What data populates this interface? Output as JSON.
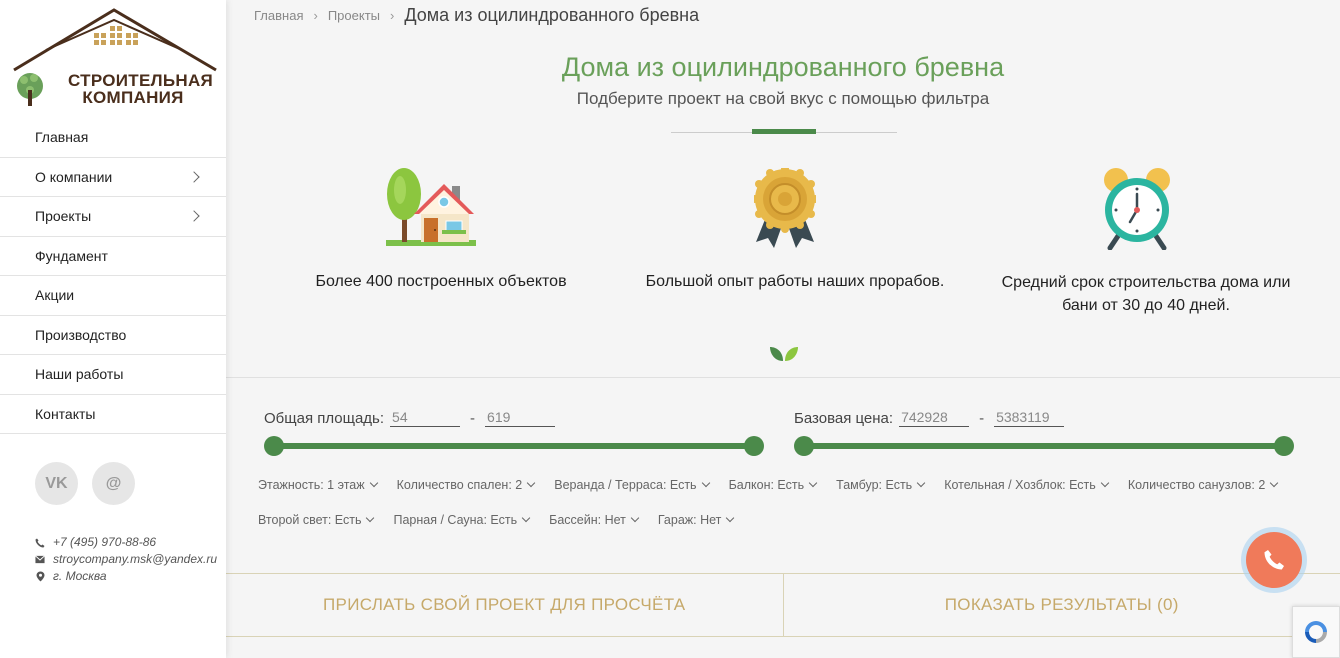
{
  "sidebar": {
    "logo": {
      "line1": "СТРОИТЕЛЬНАЯ",
      "line2": "КОМПАНИЯ"
    },
    "nav": [
      {
        "label": "Главная",
        "has_submenu": false
      },
      {
        "label": "О компании",
        "has_submenu": true
      },
      {
        "label": "Проекты",
        "has_submenu": true
      },
      {
        "label": "Фундамент",
        "has_submenu": false
      },
      {
        "label": "Акции",
        "has_submenu": false
      },
      {
        "label": "Производство",
        "has_submenu": false
      },
      {
        "label": "Наши работы",
        "has_submenu": false
      },
      {
        "label": "Контакты",
        "has_submenu": false
      }
    ],
    "socials": [
      {
        "icon": "vk-icon",
        "label": "VK"
      },
      {
        "icon": "email-at-icon",
        "label": "@"
      }
    ],
    "contacts": {
      "phone": "+7 (495) 970-88-86",
      "email": "stroycompany.msk@yandex.ru",
      "city": "г. Москва"
    }
  },
  "breadcrumb": {
    "home": "Главная",
    "projects": "Проекты",
    "current": "Дома из оцилиндрованного бревна"
  },
  "hero": {
    "title": "Дома из оцилиндрованного бревна",
    "subtitle": "Подберите проект на свой вкус с помощью фильтра"
  },
  "features": [
    {
      "icon": "house-tree-icon",
      "text": "Более 400 построенных объектов"
    },
    {
      "icon": "award-medal-icon",
      "text": "Большой опыт работы наших прорабов."
    },
    {
      "icon": "alarm-clock-icon",
      "text_line1": "Средний срок строительства дома или",
      "text_line2": "бани от 30 до 40 дней."
    }
  ],
  "filters": {
    "area": {
      "label": "Общая площадь:",
      "min": "54",
      "max": "619"
    },
    "price": {
      "label": "Базовая цена:",
      "min": "742928",
      "max": "5383119"
    },
    "row1": [
      "Этажность: 1 этаж",
      "Количество спален: 2",
      "Веранда / Терраса: Есть",
      "Балкон: Есть",
      "Тамбур: Есть",
      "Котельная / Хозблок: Есть",
      "Количество санузлов: 2"
    ],
    "row2": [
      "Второй свет: Есть",
      "Парная / Сауна: Есть",
      "Бассейн: Нет",
      "Гараж: Нет"
    ]
  },
  "actions": {
    "send_project": "ПРИСЛАТЬ СВОЙ ПРОЕКТ ДЛЯ ПРОСЧЁТА",
    "show_results": "ПОКАЗАТЬ РЕЗУЛЬТАТЫ (0)"
  },
  "colors": {
    "accent_green": "#4b8a4a",
    "title_green": "#6aa05a",
    "gold": "#c6a96a",
    "call_orange": "#f07a5a"
  }
}
